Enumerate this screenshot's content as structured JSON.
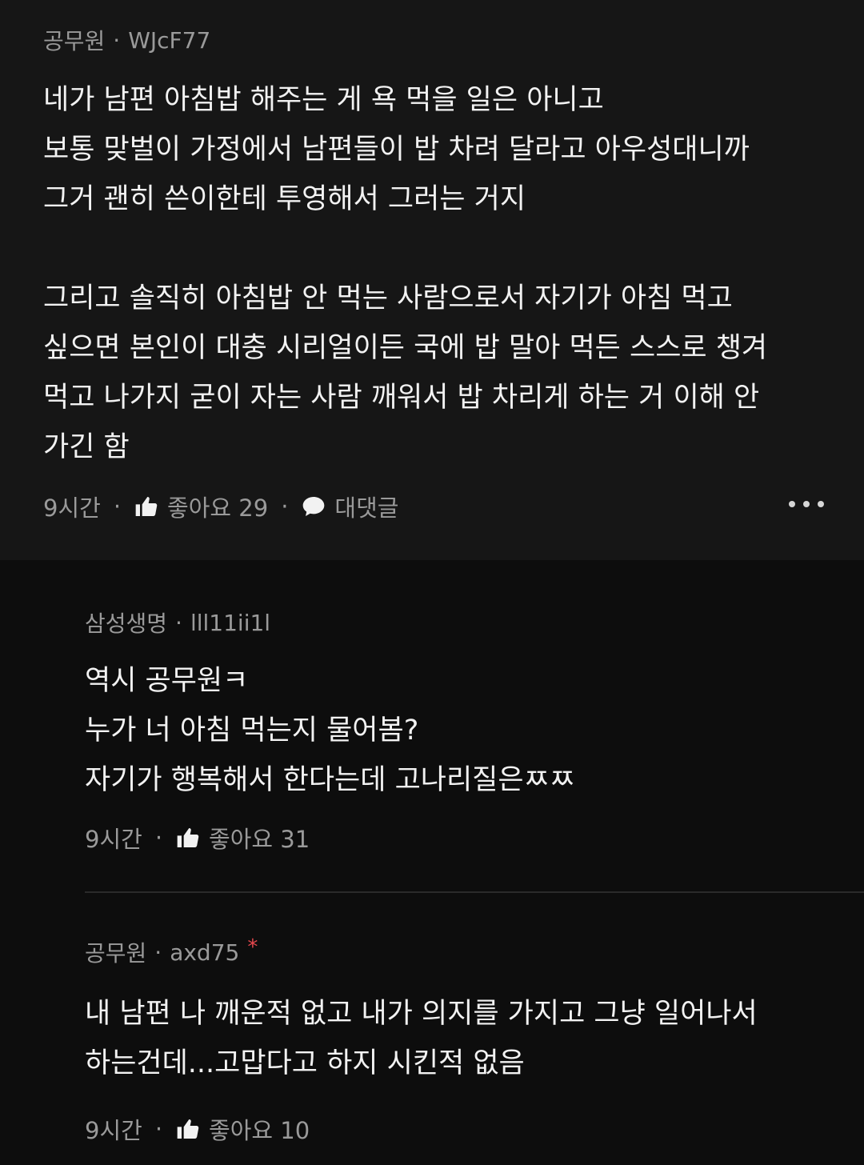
{
  "comments": [
    {
      "company": "공무원",
      "username": "WJcF77",
      "lines": [
        "네가 남편 아침밥 해주는 게 욕 먹을 일은 아니고",
        "보통 맞벌이 가정에서 남편들이 밥 차려 달라고 아우성대니까",
        "그거 괜히 쓴이한테 투영해서 그러는 거지",
        "",
        "그리고 솔직히 아침밥 안 먹는 사람으로서 자기가 아침 먹고",
        "싶으면 본인이 대충 시리얼이든 국에 밥 말아 먹든 스스로 챙겨",
        "먹고 나가지 굳이 자는 사람 깨워서 밥 차리게 하는 거 이해 안",
        "가긴 함"
      ],
      "time": "9시간",
      "like_label": "좋아요 29",
      "reply_label": "대댓글"
    }
  ],
  "replies": [
    {
      "company": "삼성생명",
      "username": "lll11ii1l",
      "lines": [
        "역시 공무원ㅋ",
        "누가 너 아침 먹는지 물어봄?",
        "자기가 행복해서 한다는데 고나리질은ㅉㅉ"
      ],
      "time": "9시간",
      "like_label": "좋아요 31"
    },
    {
      "company": "공무원",
      "username": "axd75",
      "author_mark": "*",
      "lines": [
        "내 남편 나 깨운적 없고 내가 의지를 가지고 그냥 일어나서",
        "하는건데...고맙다고 하지 시킨적 없음"
      ],
      "time": "9시간",
      "like_label": "좋아요 10"
    }
  ],
  "separator": "·",
  "icons": {
    "like": "thumbs-up-icon",
    "reply": "speech-bubble-icon",
    "more": "more-dots-icon"
  },
  "colors": {
    "background": "#0d0d0d",
    "top_comment_background": "#161616",
    "muted_text": "#9a9a9a",
    "author_mark": "#e5484d"
  }
}
